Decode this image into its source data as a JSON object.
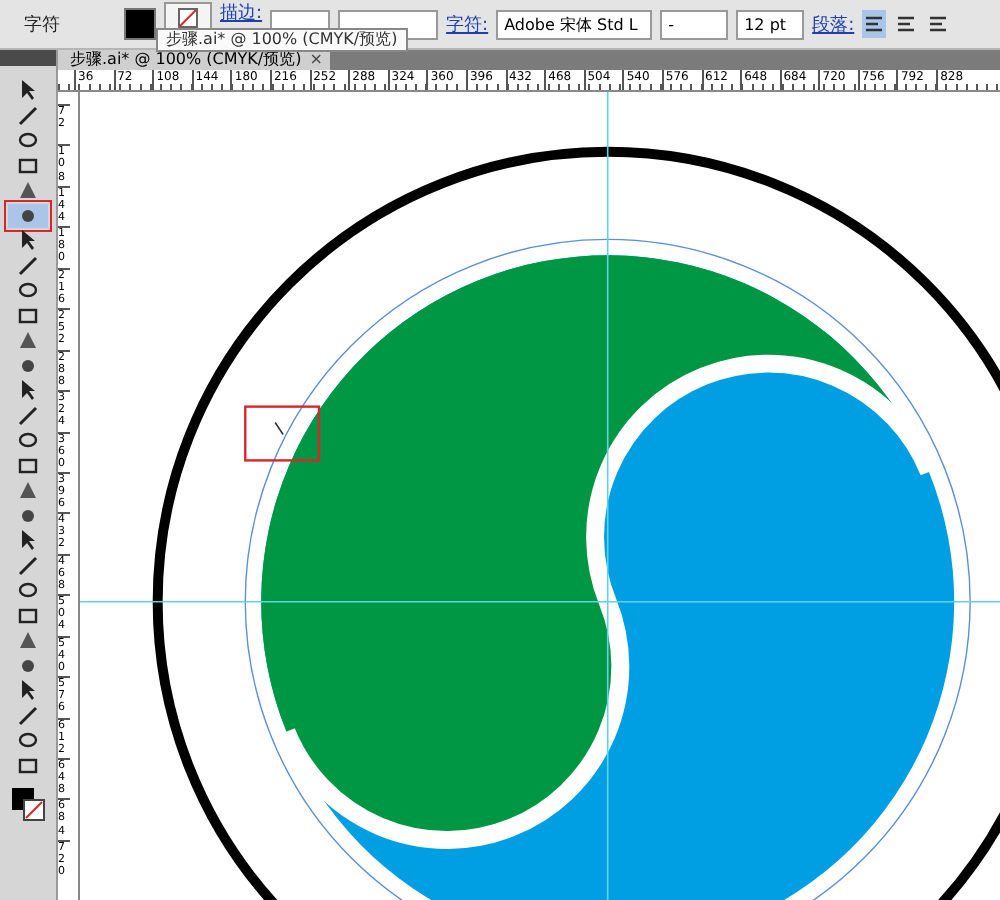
{
  "control_bar": {
    "label": "字符",
    "stroke_link": "描边:",
    "character_link": "字符:",
    "font_family": "Adobe 宋体 Std L",
    "font_style": "-",
    "font_size": "12 pt",
    "paragraph_link": "段落:",
    "align_buttons": [
      {
        "selected": true
      },
      {
        "selected": false
      },
      {
        "selected": false
      }
    ]
  },
  "tooltip": "步骤.ai* @ 100% (CMYK/预览)",
  "document_tab": {
    "title": "步骤.ai* @ 100% (CMYK/预览)",
    "close": "×"
  },
  "h_ruler": [
    "36",
    "72",
    "108",
    "144",
    "180",
    "216",
    "252",
    "288",
    "324",
    "360",
    "396",
    "432",
    "468",
    "504",
    "540",
    "576",
    "612",
    "648",
    "684",
    "720",
    "756",
    "792",
    "828"
  ],
  "v_ruler": [
    "72",
    "108",
    "144",
    "180",
    "216",
    "252",
    "288",
    "324",
    "360",
    "396",
    "432",
    "468",
    "504",
    "540",
    "576",
    "612",
    "648",
    "684",
    "720"
  ],
  "tools": [
    {
      "selected": false
    },
    {
      "selected": false
    },
    {
      "selected": false
    },
    {
      "selected": false
    },
    {
      "selected": false
    },
    {
      "selected": true
    },
    {
      "selected": false
    },
    {
      "selected": false
    },
    {
      "selected": false
    },
    {
      "selected": false
    },
    {
      "selected": false
    },
    {
      "selected": false
    },
    {
      "selected": false
    },
    {
      "selected": false
    },
    {
      "selected": false
    },
    {
      "selected": false
    },
    {
      "selected": false
    },
    {
      "selected": false
    },
    {
      "selected": false
    },
    {
      "selected": false
    },
    {
      "selected": false
    },
    {
      "selected": false
    },
    {
      "selected": false
    },
    {
      "selected": false
    },
    {
      "selected": false
    },
    {
      "selected": false
    },
    {
      "selected": false
    },
    {
      "selected": false
    }
  ]
}
